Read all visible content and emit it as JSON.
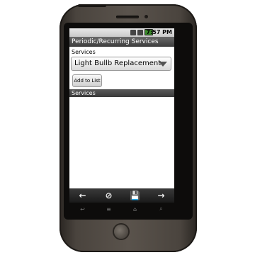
{
  "status_bar": {
    "time": "7:57 PM",
    "icons": [
      "usb-icon",
      "signal-icon",
      "battery-icon"
    ]
  },
  "title": "Periodic/Recurring Services",
  "services_label": "Services",
  "spinner": {
    "selected": "Light Bullb Replacement"
  },
  "add_button": "Add to List",
  "list_header": "Services",
  "nav_bar": {
    "back_glyph": "←",
    "cancel_glyph": "⊘",
    "save_glyph": "💾",
    "forward_glyph": "→"
  },
  "hardware_keys": {
    "back": "↩",
    "menu": "≡",
    "home": "⌂",
    "search": "⌕"
  },
  "colors": {
    "title_bar": "#4a4a4a",
    "battery": "#3a8a2a",
    "phone_body": "#4a443e"
  }
}
